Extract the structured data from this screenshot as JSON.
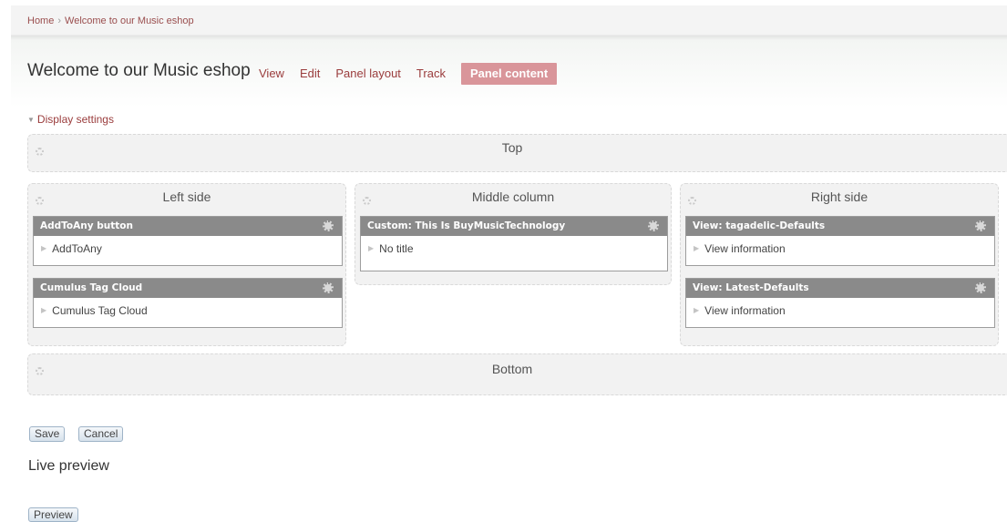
{
  "breadcrumb": {
    "home": "Home",
    "separator": "›",
    "current": "Welcome to our Music eshop"
  },
  "page_title": "Welcome to our Music eshop",
  "tabs": [
    {
      "label": "View"
    },
    {
      "label": "Edit"
    },
    {
      "label": "Panel layout"
    },
    {
      "label": "Track"
    },
    {
      "label": "Panel content",
      "active": true
    }
  ],
  "display_settings": {
    "label": "Display settings",
    "icon": "triangle-down-icon"
  },
  "regions": {
    "top": {
      "title": "Top"
    },
    "left": {
      "title": "Left side",
      "panes": [
        {
          "title": "AddToAny button",
          "body": "AddToAny"
        },
        {
          "title": "Cumulus Tag Cloud",
          "body": "Cumulus Tag Cloud"
        }
      ]
    },
    "middle": {
      "title": "Middle column",
      "panes": [
        {
          "title": "Custom: This Is BuyMusicTechnology",
          "body": "No title"
        }
      ]
    },
    "right": {
      "title": "Right side",
      "panes": [
        {
          "title": "View: tagadelic-Defaults",
          "body": "View information"
        },
        {
          "title": "View: Latest-Defaults",
          "body": "View information"
        }
      ]
    },
    "bottom": {
      "title": "Bottom"
    }
  },
  "buttons": {
    "save": "Save",
    "cancel": "Cancel",
    "preview": "Preview"
  },
  "live_preview": "Live preview",
  "colors": {
    "link": "#9a3c3c",
    "active_tab": "#d9959a",
    "pane_header": "#8a8a8a",
    "region_bg": "#f2f2f2"
  }
}
